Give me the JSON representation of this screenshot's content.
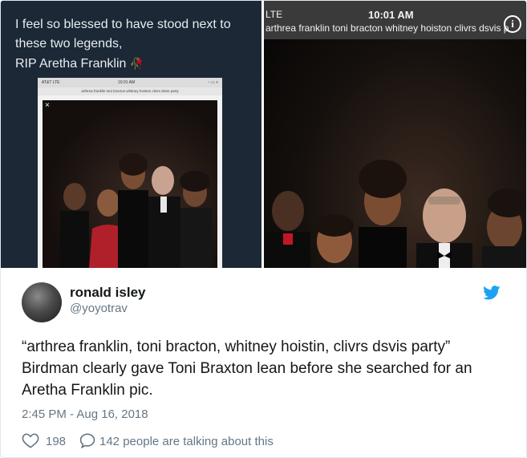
{
  "media": {
    "left_caption": {
      "line1": "I feel so blessed to have stood next to",
      "line2": "these two legends,",
      "line3": "RIP Aretha Franklin",
      "emoji": "🥀"
    },
    "inner_screenshot": {
      "carrier": "AT&T  LTE",
      "time": "10:01 AM",
      "battery": "⁃ ▭ +",
      "url": "arthrea franklin toni bracton whitney hoiston clivrs dsvis party",
      "close": "×"
    },
    "right_screenshot": {
      "carrier": "LTE",
      "time": "10:01 AM",
      "url": "arthrea franklin toni bracton whitney hoiston clivrs dsvis p",
      "info_icon": "i"
    }
  },
  "author": {
    "display_name": "ronald isley",
    "handle": "@yoyotrav"
  },
  "tweet": {
    "text": "“arthrea franklin, toni bracton, whitney hoistin, clivrs dsvis party” Birdman clearly gave Toni Braxton lean before she searched for an Aretha Franklin pic.",
    "timestamp": "2:45 PM - Aug 16, 2018"
  },
  "actions": {
    "likes": "198",
    "replies_text": "142 people are talking about this"
  },
  "colors": {
    "twitter_blue": "#1da1f2",
    "secondary_text": "#657786",
    "primary_text": "#14171a"
  }
}
